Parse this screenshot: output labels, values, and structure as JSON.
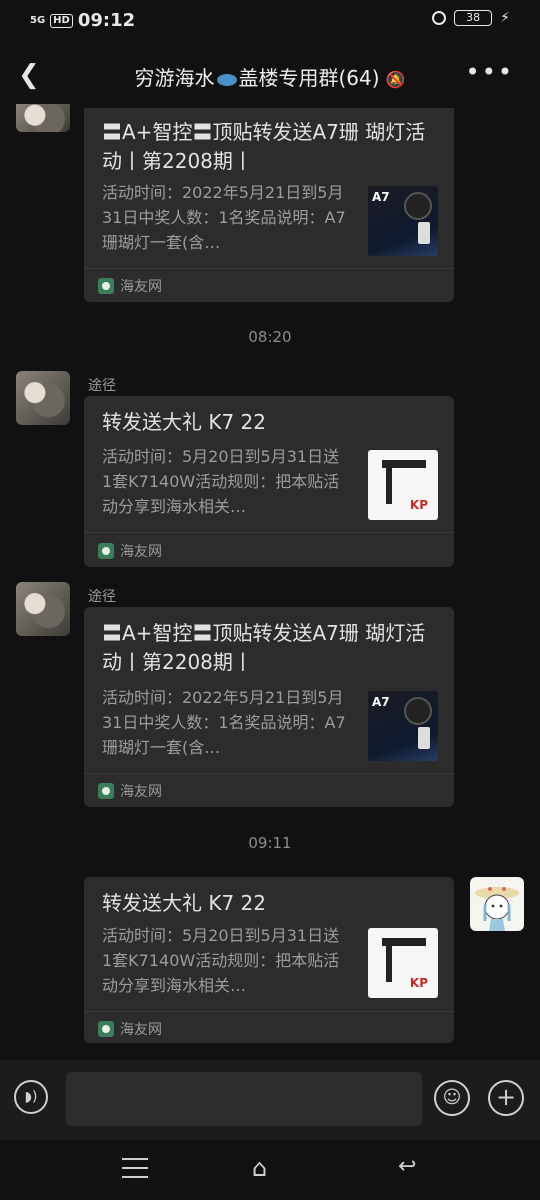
{
  "status_bar": {
    "signal": "5G",
    "hd": "HD",
    "time": "09:12",
    "battery": "38"
  },
  "header": {
    "back_icon": "chevron-left-icon",
    "title_part1": "穷游海水",
    "title_part2": "盖楼专用群(64)",
    "mute_icon": "bell-off-icon",
    "more_icon": "more-icon"
  },
  "messages": [
    {
      "title": "〓A+智控〓顶贴转发送A7珊 瑚灯活动丨第2208期丨",
      "desc": "活动时间：2022年5月21日到5月31日中奖人数：1名奖品说明：A7珊瑚灯一套(含…",
      "thumb_label": "A7",
      "source": "海友网"
    },
    {
      "timestamp": "08:20"
    },
    {
      "sender": "途径",
      "title": "转发送大礼 K7 22",
      "desc": "活动时间：5月20日到5月31日送1套K7140W活动规则：把本贴活动分享到海水相关…",
      "thumb_label": "KP",
      "source": "海友网"
    },
    {
      "sender": "途径",
      "title": "〓A+智控〓顶贴转发送A7珊 瑚灯活动丨第2208期丨",
      "desc": "活动时间：2022年5月21日到5月31日中奖人数：1名奖品说明：A7珊瑚灯一套(含…",
      "thumb_label": "A7",
      "source": "海友网"
    },
    {
      "timestamp": "09:11"
    },
    {
      "title": "转发送大礼 K7 22",
      "desc": "活动时间：5月20日到5月31日送1套K7140W活动规则：把本贴活动分享到海水相关…",
      "thumb_label": "KP",
      "source": "海友网"
    }
  ],
  "input_bar": {
    "voice_icon": "voice-icon",
    "text": "",
    "emoji_icon": "emoji-icon",
    "plus_icon": "plus-icon"
  },
  "nav_bar": {
    "menu_icon": "menu-icon",
    "home_icon": "home-icon",
    "back_icon": "back-icon"
  }
}
